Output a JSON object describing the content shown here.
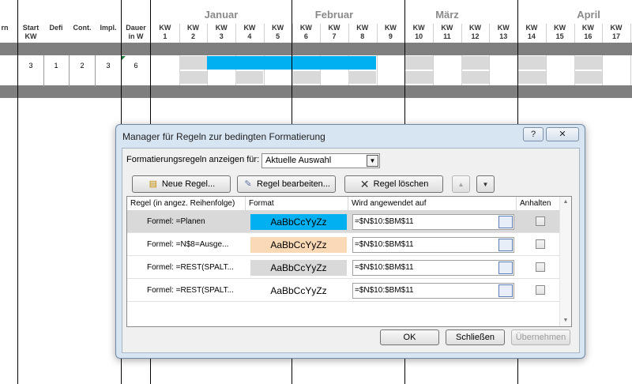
{
  "sheet": {
    "col_headers": {
      "rn": "rn",
      "start": [
        "Start",
        "KW"
      ],
      "defi": "Defi",
      "cont": "Cont.",
      "impl": "Impl.",
      "dauer": [
        "Dauer",
        "in W"
      ]
    },
    "months": [
      "Januar",
      "Februar",
      "März",
      "April"
    ],
    "kw_label": "KW",
    "weeks": [
      "1",
      "2",
      "3",
      "4",
      "5",
      "6",
      "7",
      "8",
      "9",
      "10",
      "11",
      "12",
      "13",
      "14",
      "15",
      "16",
      "17"
    ],
    "row_values": [
      "3",
      "1",
      "2",
      "3",
      "6"
    ],
    "colors": {
      "plan": "#00b0f0",
      "shade": "#d9d9d9",
      "band": "#7f7f7f"
    }
  },
  "dialog": {
    "title": "Manager für Regeln zur bedingten Formatierung",
    "help_button": "?",
    "close_button": "✕",
    "show_rules_label": "Formatierungsregeln anzeigen für:",
    "show_rules_value": "Aktuelle Auswahl",
    "buttons": {
      "new_rule": "Neue Regel...",
      "edit_rule": "Regel bearbeiten...",
      "delete_rule": "Regel löschen",
      "ok": "OK",
      "close": "Schließen",
      "apply": "Übernehmen"
    },
    "columns": {
      "rule": "Regel (in angez. Reihenfolge)",
      "format": "Format",
      "applies_to": "Wird angewendet auf",
      "stop": "Anhalten"
    },
    "rules": [
      {
        "rule": "Formel: =Planen",
        "preview": "AaBbCcYyZz",
        "color": "#00b0f0",
        "applies": "=$N$10:$BM$11",
        "stop": false,
        "selected": true
      },
      {
        "rule": "Formel: =N$8=Ausge...",
        "preview": "AaBbCcYyZz",
        "color": "#fad9b6",
        "applies": "=$N$10:$BM$11",
        "stop": false,
        "selected": false
      },
      {
        "rule": "Formel: =REST(SPALT...",
        "preview": "AaBbCcYyZz",
        "color": "#d9d9d9",
        "applies": "=$N$10:$BM$11",
        "stop": false,
        "selected": false
      },
      {
        "rule": "Formel: =REST(SPALT...",
        "preview": "AaBbCcYyZz",
        "color": "#ffffff",
        "applies": "=$N$10:$BM$11",
        "stop": false,
        "selected": false
      }
    ]
  }
}
